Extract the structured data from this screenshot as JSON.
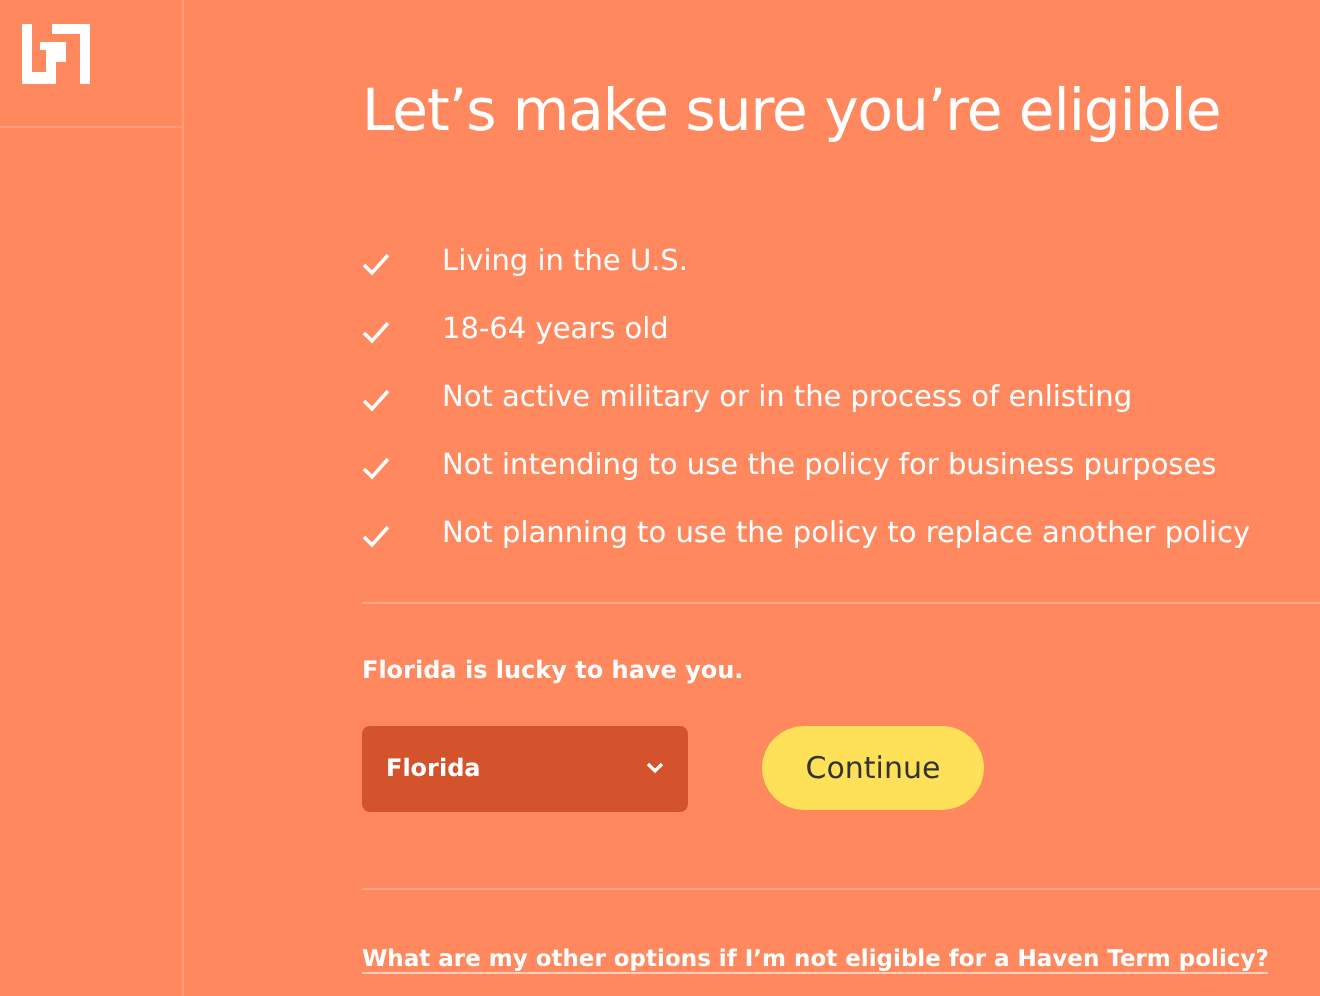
{
  "title": "Let’s make sure you’re eligible",
  "criteria": [
    {
      "label": "Living in the U.S.",
      "checked": true
    },
    {
      "label": "18-64 years old",
      "checked": true
    },
    {
      "label": "Not active military or in the process of enlisting",
      "checked": true
    },
    {
      "label": "Not intending to use the policy for business purposes",
      "checked": true
    },
    {
      "label": "Not planning to use the policy to replace another policy",
      "checked": true
    }
  ],
  "state_message": "Florida is lucky to have you.",
  "state_select": {
    "value": "Florida"
  },
  "continue_button": "Continue",
  "help_link": "What are my other options if I’m not eligible for a Haven Term policy?"
}
